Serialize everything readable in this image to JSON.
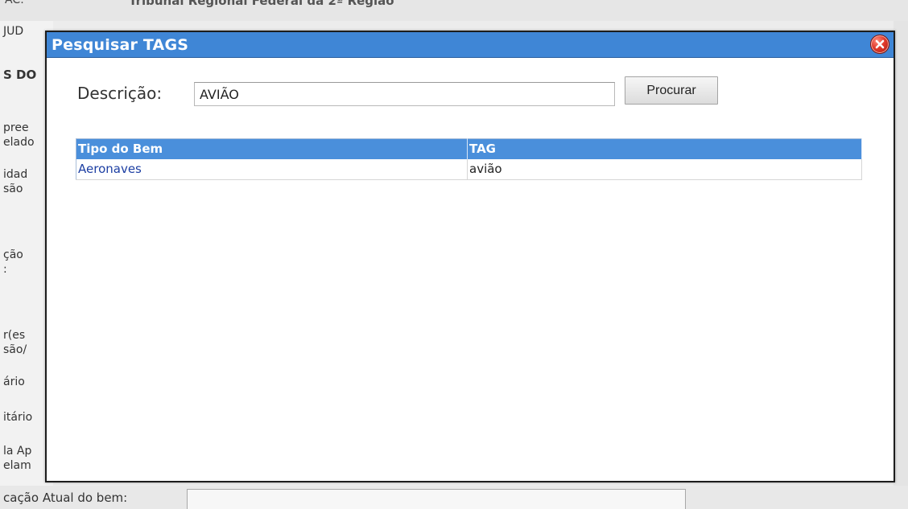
{
  "background": {
    "top_partial_left": "AC:",
    "top_partial_org": "Tribunal Regional Federal da 2ª Região",
    "left_labels": [
      "JUD",
      "S DO",
      "pree",
      "elado",
      "idad",
      "são",
      "ção",
      ":",
      "r(es",
      "são/",
      "ário",
      "itário",
      "la Ap",
      "elam"
    ],
    "bottom_label": "cação Atual do bem:"
  },
  "dialog": {
    "title": "Pesquisar TAGS",
    "close_icon": "close-icon",
    "search": {
      "label": "Descrição:",
      "value": "AVIÃO",
      "button_label": "Procurar"
    },
    "table": {
      "headers": [
        "Tipo do Bem",
        "TAG"
      ],
      "rows": [
        [
          "Aeronaves",
          "avião"
        ]
      ]
    }
  },
  "colors": {
    "header_blue": "#3f86d6",
    "table_header_blue": "#4a8fdb",
    "link_blue": "#1d3fa3",
    "close_red": "#e0392b"
  }
}
